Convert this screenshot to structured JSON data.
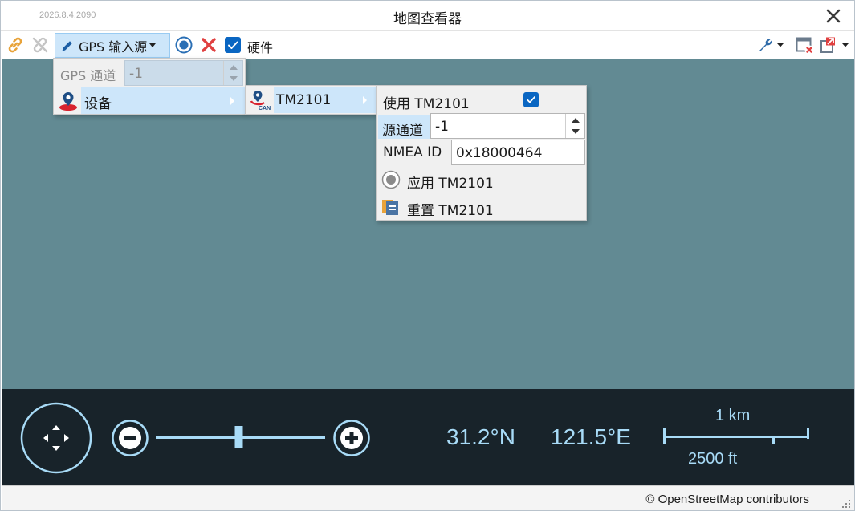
{
  "window": {
    "version": "2026.8.4.2090",
    "title": "地图查看器"
  },
  "toolbar": {
    "gps_source_label": "GPS 输入源",
    "hardware_label": "硬件",
    "hardware_checked": true
  },
  "gps_menu": {
    "channel_label": "GPS 通道",
    "channel_value": "-1",
    "device_label": "设备"
  },
  "device_menu": {
    "item_label": "TM2101",
    "item_icon": "can-device-icon"
  },
  "tm_menu": {
    "use_label": "使用 TM2101",
    "use_checked": true,
    "source_channel_label": "源通道",
    "source_channel_value": "-1",
    "nmea_id_label": "NMEA ID",
    "nmea_id_value": "0x18000464",
    "apply_label": "应用 TM2101",
    "reset_label": "重置 TM2101"
  },
  "map": {
    "latitude": "31.2°N",
    "longitude": "121.5°E",
    "scale_metric": "1 km",
    "scale_imperial": "2500 ft",
    "zoom_level": 0.49,
    "attribution": "© OpenStreetMap contributors"
  },
  "colors": {
    "map_water": "#628a93",
    "panel_bg": "#18232a",
    "control_accent": "#a8dbf7",
    "menu_highlight": "#cde6fa",
    "checkbox": "#0a66c2",
    "delete_red": "#e04040"
  }
}
